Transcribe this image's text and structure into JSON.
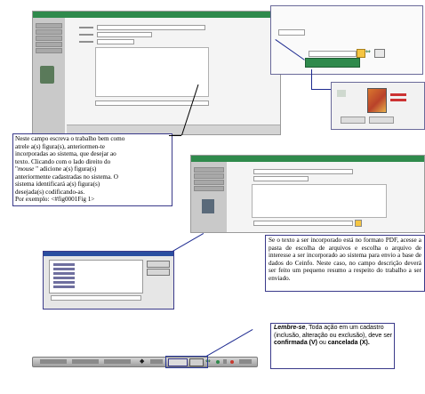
{
  "note_editor": {
    "line1": "Neste campo escreva o trabalho  bem como",
    "line2": "atrele        a(s)      figura(s),      anteriormen-te",
    "line3": "incorporadas  ao  sistema,  que  desejar  ao",
    "line4": "texto.  Clicando  com  o  lado  direito  do",
    "line5_pre": "\"",
    "line5_em": "mouse",
    "line5_post": "   \"       adicione      a(s)      figura(s)",
    "line6": "anteriormente  cadastradas  no  sistema.  O",
    "line7": "sistema      identificará      a(s)       figura(s)",
    "line8": "desejada(s)  codificando-as.",
    "line9": "Por exemplo: <#fig0001Fig 1>"
  },
  "note_pdf": {
    "text": "Se o texto a ser incorporado está no formato PDF, acesse a pasta de escolha de arquivos e escolha o arquivo de interesse a ser incorporado ao sistema para envio a base de dados do Ceinfo. Neste caso, no campo descrição deverá ser feito um pequeno resumo a respeito do trabalho a ser enviado."
  },
  "note_remember": {
    "lead": "Lembre-se",
    "part1": ", Toda ação em um cadastro  (inclusão, alteração ou exclusão), deve ser ",
    "confirm": "confirmada (V)",
    "part2": " ou  ",
    "cancel": "cancelada  (X)."
  },
  "colors": {
    "app_bar": "#2f8a4c",
    "callout_line": "#1d2a90"
  },
  "icons": [
    "confirm-icon",
    "cancel-icon",
    "folder-icon",
    "arrow-icon"
  ]
}
